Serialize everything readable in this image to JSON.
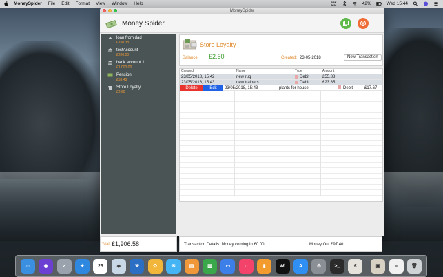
{
  "menubar": {
    "app_name": "MoneySpider",
    "items": [
      "File",
      "Edit",
      "Format",
      "View",
      "Window",
      "Help"
    ],
    "battery_percent": "42%",
    "clock": "Wed 15:44",
    "mini_top": "BRK",
    "mini_bottom": "56%"
  },
  "window": {
    "title": "MoneySpider",
    "app_title": "Money Spider"
  },
  "accounts": [
    {
      "name": "loan from dad",
      "balance": "£150.38"
    },
    {
      "name": "testAccount",
      "balance": "£200.00"
    },
    {
      "name": "bank account 1",
      "balance": "£1,000.00"
    },
    {
      "name": "Pension",
      "balance": "£53.43"
    },
    {
      "name": "Store Loyalty",
      "balance": "£2.60"
    }
  ],
  "store": {
    "title": "Store Loyalty",
    "balance_label": "Balance:",
    "balance_value": "£2.60",
    "created_label": "Created:",
    "created_value": "23-05-2018",
    "new_tx_label": "New Transaction"
  },
  "table": {
    "headers": [
      "Created",
      "Name",
      "Type",
      "Amount"
    ],
    "rows": [
      {
        "created": "23/05/2018, 15:42",
        "name": "new rug",
        "type": "Debit",
        "amount": "£55.88"
      },
      {
        "created": "23/05/2018, 15:43",
        "name": "new trainers",
        "type": "Debit",
        "amount": "£23.85"
      }
    ],
    "swipe_row": {
      "delete_label": "Delete",
      "edit_label": "Edit",
      "created": "23/05/2018, 15:43",
      "name": "plants for house",
      "type": "Debit",
      "amount": "£17.67"
    }
  },
  "footer": {
    "total_label": "Total",
    "total_value": "£1,906.58",
    "details_text": "Transaction Details: Money coming in   £0.00",
    "money_out": "Money Out   £97.40"
  },
  "dock": [
    {
      "icon": "finder-icon",
      "color": "#3a8fe0",
      "glyph": "☺"
    },
    {
      "icon": "siri-icon",
      "color": "#6b3fd1",
      "glyph": "◉"
    },
    {
      "icon": "launchpad-icon",
      "color": "#9aa3ad",
      "glyph": "➚"
    },
    {
      "icon": "safari-icon",
      "color": "#2e88e0",
      "glyph": "✦"
    },
    {
      "icon": "calendar-icon",
      "color": "#ffffff",
      "glyph": "23"
    },
    {
      "icon": "preview-icon",
      "color": "#c9d8e6",
      "glyph": "◈"
    },
    {
      "icon": "xcode-icon",
      "color": "#2a6fc4",
      "glyph": "⚒"
    },
    {
      "icon": "photos-icon",
      "color": "#f2b63a",
      "glyph": "✿"
    },
    {
      "icon": "messages-icon",
      "color": "#44b4f5",
      "glyph": "✉"
    },
    {
      "icon": "keynote-icon",
      "color": "#f0973a",
      "glyph": "▤"
    },
    {
      "icon": "numbers-icon",
      "color": "#3aa84a",
      "glyph": "▥"
    },
    {
      "icon": "keynote-presentation-icon",
      "color": "#3d7fe8",
      "glyph": "▭"
    },
    {
      "icon": "music-icon",
      "color": "#f4436b",
      "glyph": "♫"
    },
    {
      "icon": "books-icon",
      "color": "#f39b2c",
      "glyph": "▮"
    },
    {
      "icon": "wifi-explorer-icon",
      "color": "#111111",
      "glyph": "Wi"
    },
    {
      "icon": "app-store-icon",
      "color": "#2f8ff2",
      "glyph": "A"
    },
    {
      "icon": "system-preferences-icon",
      "color": "#8a8f95",
      "glyph": "⚙"
    },
    {
      "icon": "terminal-icon",
      "color": "#2b2b2b",
      "glyph": ">_"
    },
    {
      "icon": "money-spider-icon",
      "color": "#e6e3dc",
      "glyph": "£"
    },
    {
      "icon": "image-capture-icon",
      "color": "#d8d2c4",
      "glyph": "▣"
    },
    {
      "icon": "document-icon",
      "color": "#f1f1f1",
      "glyph": "≡"
    },
    {
      "icon": "trash-icon",
      "color": "#cfd3d6",
      "glyph": "🗑"
    }
  ]
}
